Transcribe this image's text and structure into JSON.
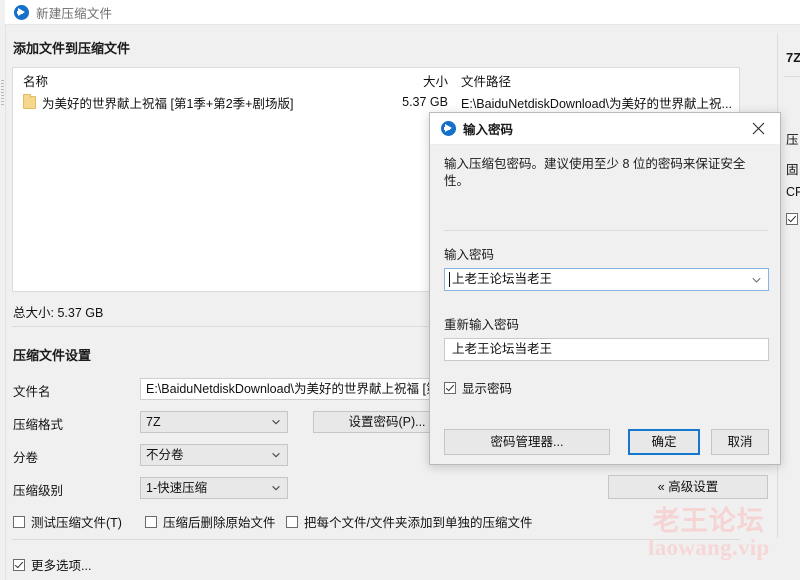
{
  "window": {
    "title": "新建压缩文件",
    "app_icon": "archive-app-icon"
  },
  "main": {
    "section_add_files": "添加文件到压缩文件",
    "file_list": {
      "columns": [
        "名称",
        "大小",
        "文件路径"
      ],
      "rows": [
        {
          "name": "为美好的世界献上祝福 [第1季+第2季+剧场版]",
          "size": "5.37 GB",
          "path": "E:\\BaiduNetdiskDownload\\为美好的世界献上祝..."
        }
      ]
    },
    "total_size": "总大小: 5.37 GB",
    "section_archive_settings": "压缩文件设置",
    "fields": {
      "filename_label": "文件名",
      "filename_value": "E:\\BaiduNetdiskDownload\\为美好的世界献上祝福 [第",
      "format_label": "压缩格式",
      "format_value": "7Z",
      "set_password_button": "设置密码(P)...",
      "volume_label": "分卷",
      "volume_value": "不分卷",
      "level_label": "压缩级别",
      "level_value": "1-快速压缩"
    },
    "checkboxes": [
      {
        "label": "测试压缩文件(T)",
        "checked": false
      },
      {
        "label": "压缩后删除原始文件",
        "checked": false
      },
      {
        "label": "把每个文件/文件夹添加到单独的压缩文件",
        "checked": false
      }
    ],
    "advanced_button": "« 高级设置",
    "more_options": {
      "label": "更多选项...",
      "checked": true
    }
  },
  "right_panel": {
    "title": "7Z",
    "labels": [
      "压",
      "固",
      "CP"
    ],
    "checkbox_checked": true
  },
  "password_dialog": {
    "title": "输入密码",
    "icon": "archive-app-icon",
    "close_icon": "close-icon",
    "description": "输入压缩包密码。建议使用至少 8 位的密码来保证安全性。",
    "password_label": "输入密码",
    "password_value": "上老王论坛当老王",
    "confirm_label": "重新输入密码",
    "confirm_value": "上老王论坛当老王",
    "show_password": {
      "label": "显示密码",
      "checked": true
    },
    "buttons": {
      "manager": "密码管理器...",
      "ok": "确定",
      "cancel": "取消"
    }
  },
  "watermark": {
    "line1": "老王论坛",
    "line2": "laowang.vip",
    "color": "#f6d4d4"
  },
  "colors": {
    "accent": "#1478cd",
    "window_bg": "#f0f0f0",
    "field_bg": "#ffffff",
    "control_bg": "#e8e8e8"
  }
}
